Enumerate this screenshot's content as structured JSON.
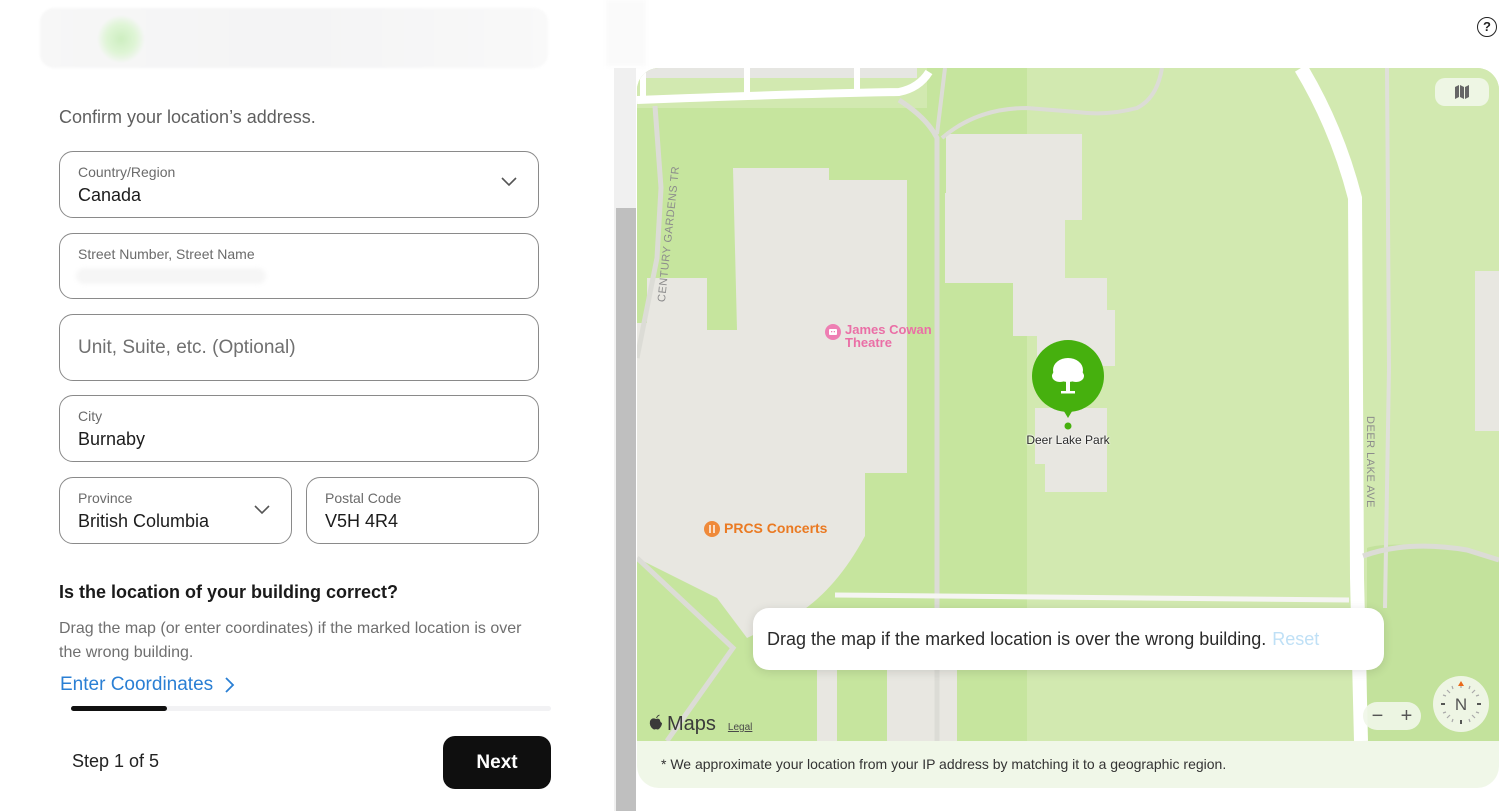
{
  "form": {
    "intro": "Confirm your location’s address.",
    "country": {
      "label": "Country/Region",
      "value": "Canada"
    },
    "street": {
      "label": "Street Number, Street Name",
      "value": ""
    },
    "unit": {
      "placeholder": "Unit, Suite, etc. (Optional)",
      "value": ""
    },
    "city": {
      "label": "City",
      "value": "Burnaby"
    },
    "province": {
      "label": "Province",
      "value": "British Columbia"
    },
    "postal": {
      "label": "Postal Code",
      "value": "V5H 4R4"
    },
    "question_title": "Is the location of your building correct?",
    "question_desc": "Drag the map (or enter coordinates) if the marked location is over the wrong building.",
    "enter_coordinates_label": "Enter Coordinates"
  },
  "footer": {
    "progress_fraction": 0.2,
    "step_label": "Step 1 of 5",
    "next_label": "Next"
  },
  "header": {
    "help_icon": "?"
  },
  "map": {
    "pois": {
      "theatre_line1": "James Cowan",
      "theatre_line2": "Theatre",
      "concerts": "PRCS Concerts",
      "park": "Deer Lake Park"
    },
    "streets": {
      "century": "CENTURY GARDENS TR",
      "deer_lake": "DEER LAKE AVE"
    },
    "tip": "Drag the map if the marked location is over the wrong building.",
    "reset_label": "Reset",
    "brand": "Maps",
    "legal_label": "Legal",
    "zoom_out": "−",
    "zoom_in": "+",
    "compass_label": "N",
    "disclaimer": "* We approximate your location from your IP address by matching it to a geographic region.",
    "colors": {
      "park_green": "#c6e59e",
      "light_green": "#d2e9b0",
      "building": "#e8e7e1",
      "pin_green": "#46b00e",
      "theatre_pink": "#ea6fa6",
      "concerts_orange": "#ea7a22",
      "reset_blue": "#bfe0f6"
    }
  }
}
